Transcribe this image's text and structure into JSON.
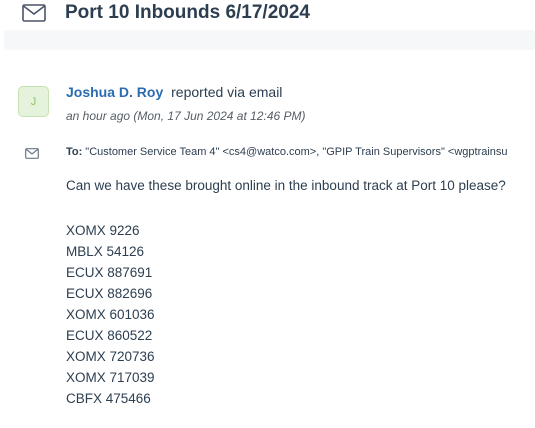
{
  "ticket": {
    "title": "Port 10 Inbounds 6/17/2024"
  },
  "message": {
    "avatar_initial": "J",
    "sender_name": "Joshua D. Roy",
    "sender_action": "reported via email",
    "timestamp": "an hour ago (Mon, 17 Jun 2024 at 12:46 PM)",
    "to_label": "To:",
    "to_value": "\"Customer Service Team 4\" <cs4@watco.com>, \"GPIP Train Supervisors\" <wgptrainsu",
    "body_intro": "Can we have these brought online in the inbound track at Port 10 please?",
    "cars": [
      "XOMX 9226",
      "MBLX 54126",
      "ECUX 887691",
      "ECUX 882696",
      "XOMX 601036",
      "ECUX 860522",
      "XOMX 720736",
      "XOMX 717039",
      "CBFX 475466"
    ]
  },
  "icons": {
    "header_icon": "envelope-icon",
    "to_icon": "envelope-icon"
  },
  "colors": {
    "sender_link": "#2b6cb0",
    "avatar_bg": "#e5f3dc",
    "avatar_text": "#8bc26a",
    "text": "#2c3e50"
  }
}
